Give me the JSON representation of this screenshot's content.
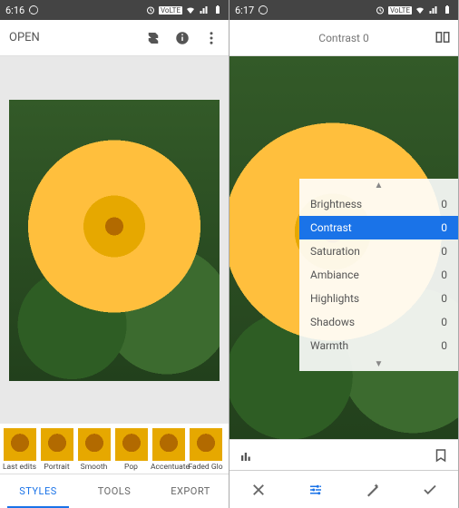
{
  "left": {
    "status": {
      "time": "6:16"
    },
    "toolbar": {
      "open": "OPEN"
    },
    "styles": [
      "Last edits",
      "Portrait",
      "Smooth",
      "Pop",
      "Accentuate",
      "Faded Glo"
    ],
    "tabs": {
      "styles": "STYLES",
      "tools": "TOOLS",
      "export": "EXPORT"
    }
  },
  "right": {
    "status": {
      "time": "6:17"
    },
    "header": {
      "label": "Contrast",
      "value": "0"
    },
    "adjustments": [
      {
        "label": "Brightness",
        "value": "0",
        "active": false
      },
      {
        "label": "Contrast",
        "value": "0",
        "active": true
      },
      {
        "label": "Saturation",
        "value": "0",
        "active": false
      },
      {
        "label": "Ambiance",
        "value": "0",
        "active": false
      },
      {
        "label": "Highlights",
        "value": "0",
        "active": false
      },
      {
        "label": "Shadows",
        "value": "0",
        "active": false
      },
      {
        "label": "Warmth",
        "value": "0",
        "active": false
      }
    ]
  }
}
